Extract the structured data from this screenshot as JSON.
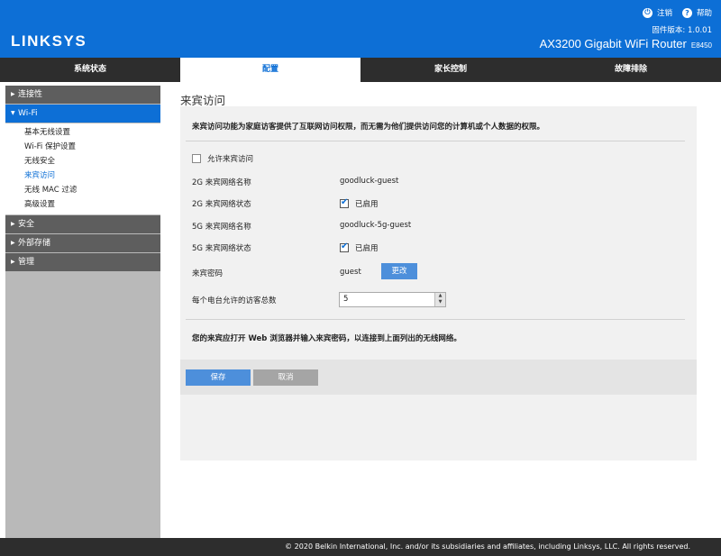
{
  "header": {
    "brand": "LINKSYS",
    "logout_label": "注销",
    "help_label": "帮助",
    "firmware": "固件版本: 1.0.01",
    "model": "AX3200 Gigabit WiFi Router",
    "model_code": "E8450"
  },
  "nav": {
    "tabs": [
      {
        "label": "系统状态"
      },
      {
        "label": "配置"
      },
      {
        "label": "家长控制"
      },
      {
        "label": "故障排除"
      }
    ]
  },
  "sidebar": {
    "sections": [
      {
        "label": "连接性"
      },
      {
        "label": "Wi-Fi"
      },
      {
        "label": "安全"
      },
      {
        "label": "外部存储"
      },
      {
        "label": "管理"
      }
    ],
    "wifi_items": [
      {
        "label": "基本无线设置"
      },
      {
        "label": "Wi-Fi 保护设置"
      },
      {
        "label": "无线安全"
      },
      {
        "label": "来宾访问"
      },
      {
        "label": "无线 MAC 过滤"
      },
      {
        "label": "高级设置"
      }
    ]
  },
  "page": {
    "title": "来宾访问",
    "intro": "来宾访问功能为家庭访客提供了互联网访问权限，而无需为他们提供访问您的计算机或个人数据的权限。",
    "allow_guest_label": "允许来宾访问",
    "allow_guest_checked": false,
    "rows": {
      "ssid_2g_label": "2G 来宾网络名称",
      "ssid_2g_value": "goodluck-guest",
      "status_2g_label": "2G 来宾网络状态",
      "status_2g_value": "已启用",
      "ssid_5g_label": "5G 来宾网络名称",
      "ssid_5g_value": "goodluck-5g-guest",
      "status_5g_label": "5G 来宾网络状态",
      "status_5g_value": "已启用",
      "password_label": "来宾密码",
      "password_value": "guest",
      "change_label": "更改",
      "max_guests_label": "每个电台允许的访客总数",
      "max_guests_value": "5"
    },
    "note": "您的来宾应打开 Web 浏览器并输入来宾密码，以连接到上面列出的无线网络。",
    "save_label": "保存",
    "cancel_label": "取消"
  },
  "footer": {
    "copyright": "© 2020 Belkin International, Inc. and/or its subsidiaries and affiliates, including Linksys, LLC. All rights reserved."
  },
  "colors": {
    "brand_blue": "#0d6fd6",
    "nav_dark": "#2d2d2d",
    "sidebar_gray": "#b9b9b9"
  }
}
